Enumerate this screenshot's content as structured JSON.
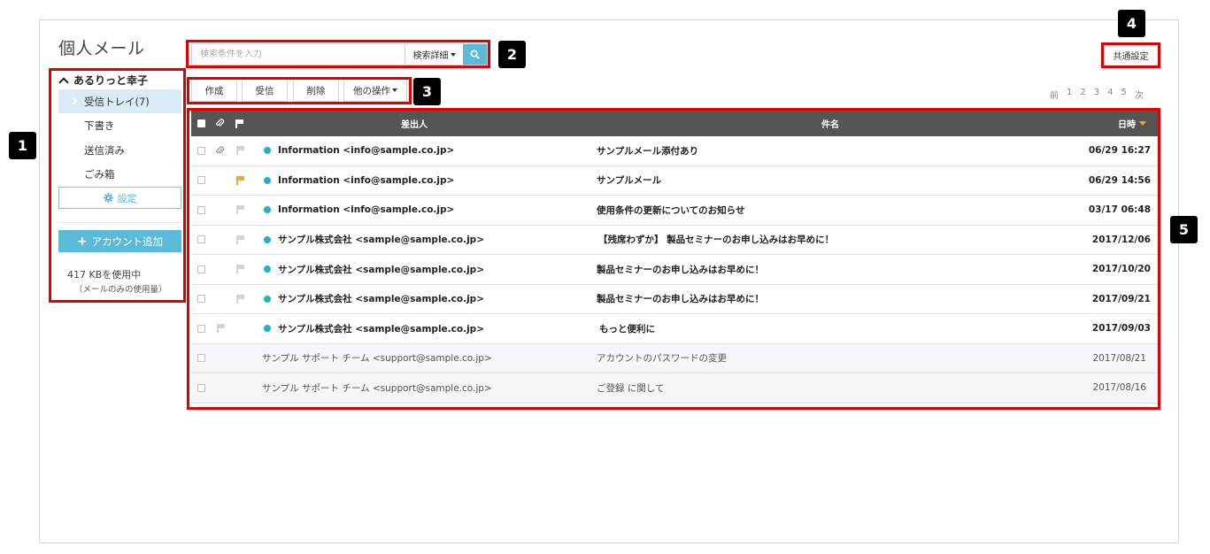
{
  "app_title": "個人メール",
  "sidebar": {
    "account_name": "あるりっと幸子",
    "folders": [
      {
        "label": "受信トレイ(7)",
        "active": true
      },
      {
        "label": "下書き",
        "active": false
      },
      {
        "label": "送信済み",
        "active": false
      },
      {
        "label": "ごみ箱",
        "active": false
      }
    ],
    "settings_label": "設定",
    "add_account_label": "アカウント追加",
    "usage": "417 KBを使用中",
    "usage_note": "（メールのみの使用量）"
  },
  "search": {
    "placeholder": "検索条件を入力",
    "detail_label": "検索詳細"
  },
  "actions": {
    "compose": "作成",
    "receive": "受信",
    "delete": "削除",
    "more": "他の操作"
  },
  "common_settings": "共通設定",
  "pager": [
    "前",
    "1",
    "2",
    "3",
    "4",
    "5",
    "次"
  ],
  "table": {
    "headers": {
      "from": "差出人",
      "subject": "件名",
      "date": "日時"
    },
    "rows": [
      {
        "from": "Information <info@sample.co.jp>",
        "subject": "サンプルメール添付あり",
        "date": "06/29 16:27",
        "unread": true,
        "attachment": true,
        "flag": "grey",
        "dot": true
      },
      {
        "from": "Information <info@sample.co.jp>",
        "subject": "サンプルメール",
        "date": "06/29 14:56",
        "unread": true,
        "attachment": false,
        "flag": "orange",
        "dot": true
      },
      {
        "from": "Information <info@sample.co.jp>",
        "subject": "使用条件の更新についてのお知らせ",
        "date": "03/17 06:48",
        "unread": true,
        "attachment": false,
        "flag": "grey",
        "dot": true
      },
      {
        "from": "サンプル株式会社 <sample@sample.co.jp>",
        "subject": "【残席わずか】 製品セミナーのお申し込みはお早めに！",
        "date": "2017/12/06",
        "unread": true,
        "attachment": false,
        "flag": "grey",
        "dot": true
      },
      {
        "from": "サンプル株式会社 <sample@sample.co.jp>",
        "subject": "製品セミナーのお申し込みはお早めに！",
        "date": "2017/10/20",
        "unread": true,
        "attachment": false,
        "flag": "grey",
        "dot": true
      },
      {
        "from": "サンプル株式会社 <sample@sample.co.jp>",
        "subject": "製品セミナーのお申し込みはお早めに！",
        "date": "2017/09/21",
        "unread": true,
        "attachment": false,
        "flag": "grey",
        "dot": true
      },
      {
        "from": "サンプル株式会社 <sample@sample.co.jp>",
        "subject": "もっと便利に",
        "date": "2017/09/03",
        "unread": true,
        "attachment": false,
        "flag": "grey",
        "dot": true
      },
      {
        "from": "サンプル サポート チーム <support@sample.co.jp>",
        "subject": "アカウントのパスワードの変更",
        "date": "2017/08/21",
        "unread": false,
        "attachment": false,
        "flag": "none",
        "dot": false
      },
      {
        "from": "サンプル サポート チーム <support@sample.co.jp>",
        "subject": "ご登録 に関して",
        "date": "2017/08/16",
        "unread": false,
        "attachment": false,
        "flag": "none",
        "dot": false
      }
    ]
  },
  "callouts": [
    "1",
    "2",
    "3",
    "4",
    "5"
  ],
  "colors": {
    "accent": "#5bbad5",
    "highlight": "#e00000",
    "header_bg": "#555555",
    "unread_dot": "#1db3c4",
    "flag_orange": "#f5a623"
  }
}
